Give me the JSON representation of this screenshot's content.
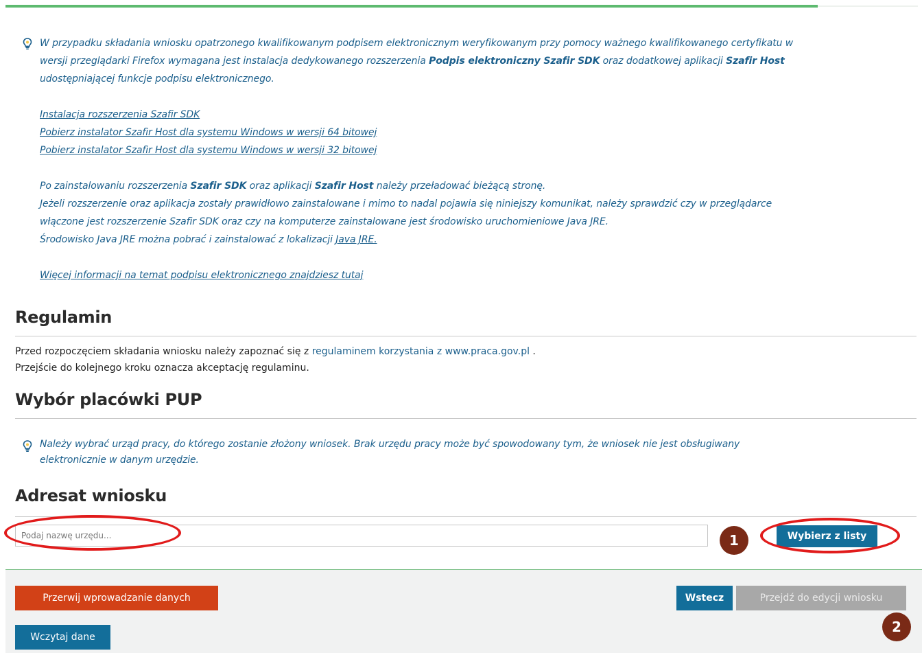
{
  "colors": {
    "accent_blue": "#136e9a",
    "danger_red": "#d24117",
    "disabled_grey": "#a8a8a8",
    "progress_green": "#5dba6f",
    "info_text": "#1b5f8c",
    "annotation_red": "#e11b1b",
    "marker_brown": "#7a2a16"
  },
  "progress": {
    "fraction": 0.89
  },
  "signature_info": {
    "icon": "lightbulb-icon",
    "intro_1": "W przypadku składania wniosku opatrzonego kwalifikowanym podpisem elektronicznym weryfikowanym przy pomocy ważnego kwalifikowanego certyfikatu w",
    "intro_2a": "wersji przeglądarki Firefox wymagana jest instalacja dedykowanego rozszerzenia ",
    "intro_2b": "Podpis elektroniczny Szafir SDK",
    "intro_2c": " oraz dodatkowej aplikacji ",
    "intro_2d": "Szafir Host",
    "intro_3": "udostępniającej funkcje podpisu elektronicznego.",
    "link_sdk": "Instalacja rozszerzenia Szafir SDK",
    "link_host64": "Pobierz instalator Szafir Host dla systemu Windows w wersji 64 bitowej",
    "link_host32": "Pobierz instalator Szafir Host dla systemu Windows w wersji 32 bitowej",
    "after_1a": "Po zainstalowaniu rozszerzenia ",
    "after_1b": "Szafir SDK",
    "after_1c": " oraz aplikacji ",
    "after_1d": "Szafir Host",
    "after_1e": " należy przeładować bieżącą stronę.",
    "after_2": "Jeżeli rozszerzenie oraz aplikacja zostały prawidłowo zainstalowane i mimo to nadal pojawia się niniejszy komunikat, należy sprawdzić czy w przeglądarce",
    "after_3": "włączone jest rozszerzenie Szafir SDK oraz czy na komputerze zainstalowane jest środowisko uruchomieniowe Java JRE.",
    "after_4": "Środowisko Java JRE można pobrać i zainstalować z lokalizacji ",
    "link_java": "Java JRE.",
    "link_more": "Więcej informacji na temat podpisu elektronicznego znajdziesz tutaj"
  },
  "regulamin": {
    "title": "Regulamin",
    "line_1a": "Przed rozpoczęciem składania wniosku należy zapoznać się z ",
    "line_1_link": "regulaminem korzystania z www.praca.gov.pl",
    "line_1b": " .",
    "line_2": "Przejście do kolejnego kroku oznacza akceptację regulaminu."
  },
  "office_choice": {
    "title": "Wybór placówki PUP",
    "icon": "lightbulb-icon",
    "info_1": "Należy wybrać urząd pracy, do którego zostanie złożony wniosek. Brak urzędu pracy może być spowodowany tym, że wniosek nie jest obsługiwany",
    "info_2": "elektronicznie w danym urzędzie."
  },
  "addressee": {
    "title": "Adresat wniosku",
    "search_placeholder": "Podaj nazwę urzędu...",
    "search_value": "",
    "choose_button": "Wybierz z listy"
  },
  "annotations": {
    "marker_1": "1",
    "marker_2": "2"
  },
  "footer": {
    "abort_button": "Przerwij wprowadzanie danych",
    "back_button": "Wstecz",
    "next_button": "Przejdź do edycji wniosku",
    "load_button": "Wczytaj dane"
  }
}
